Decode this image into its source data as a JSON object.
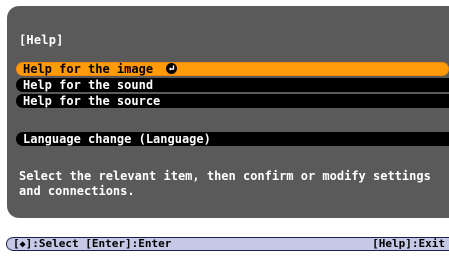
{
  "menu": {
    "title": "[Help]",
    "items": [
      {
        "label": "Help for the image",
        "selected": true
      },
      {
        "label": "Help for the sound",
        "selected": false
      },
      {
        "label": "Help for the source",
        "selected": false
      },
      {
        "label": "Language change (Language)",
        "selected": false
      }
    ],
    "description": "Select the relevant item, then confirm or modify settings and connections."
  },
  "footer": {
    "bracket_open": "[",
    "updown_icon": "◆",
    "select_hint": "]:Select [Enter]:Enter",
    "exit_hint": "[Help]:Exit"
  },
  "colors": {
    "panel_bg": "#5a5a5a",
    "item_bg": "#000000",
    "selected_bg": "#ff9a0a",
    "footer_bg": "#c5c9e6"
  },
  "icons": {
    "selected_item_icon": "enter-icon",
    "footer_icon": "up-down-icon"
  }
}
